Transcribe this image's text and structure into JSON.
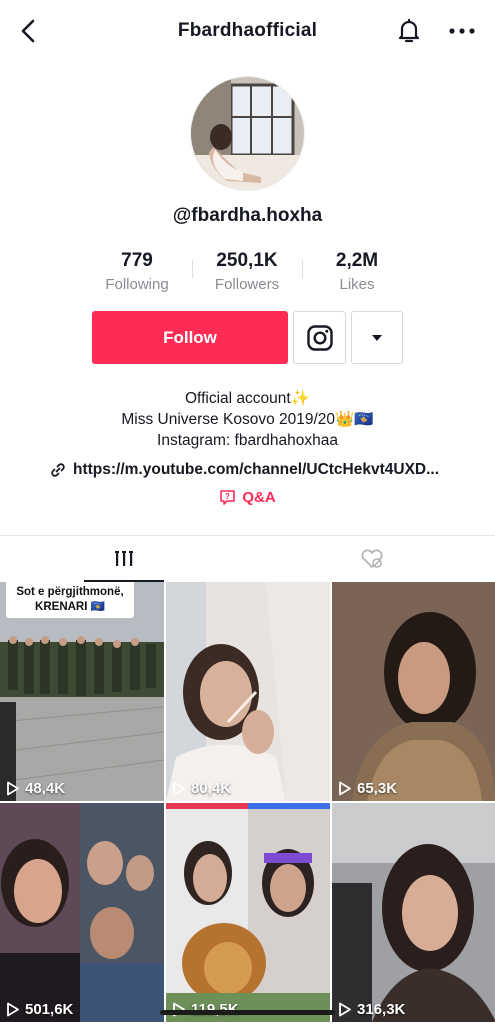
{
  "header": {
    "title": "Fbardhaofficial",
    "icons": [
      "back-icon",
      "bell-icon",
      "more-icon"
    ]
  },
  "profile": {
    "username": "@fbardha.hoxha",
    "stats": [
      {
        "value": "779",
        "label": "Following"
      },
      {
        "value": "250,1K",
        "label": "Followers"
      },
      {
        "value": "2,2M",
        "label": "Likes"
      }
    ],
    "follow_label": "Follow",
    "bio": [
      "Official account✨",
      "Miss Universe Kosovo 2019/20👑🇽🇰",
      "Instagram: fbardhahoxhaa"
    ],
    "link": "https://m.youtube.com/channel/UCtcHekvt4UXD...",
    "qa_label": "Q&A"
  },
  "tabs": [
    {
      "icon": "videos-grid-icon",
      "active": true
    },
    {
      "icon": "liked-videos-icon",
      "active": false
    }
  ],
  "videos": [
    {
      "views": "48,4K",
      "overlay": "Sot e përgjithmonë, KRENARI 🇽🇰"
    },
    {
      "views": "80,4K"
    },
    {
      "views": "65,3K"
    },
    {
      "views": "501,6K"
    },
    {
      "views": "119,5K"
    },
    {
      "views": "316,3K"
    }
  ],
  "colors": {
    "accent": "#fe2c55",
    "text": "#161823",
    "muted": "#8a8b91"
  }
}
